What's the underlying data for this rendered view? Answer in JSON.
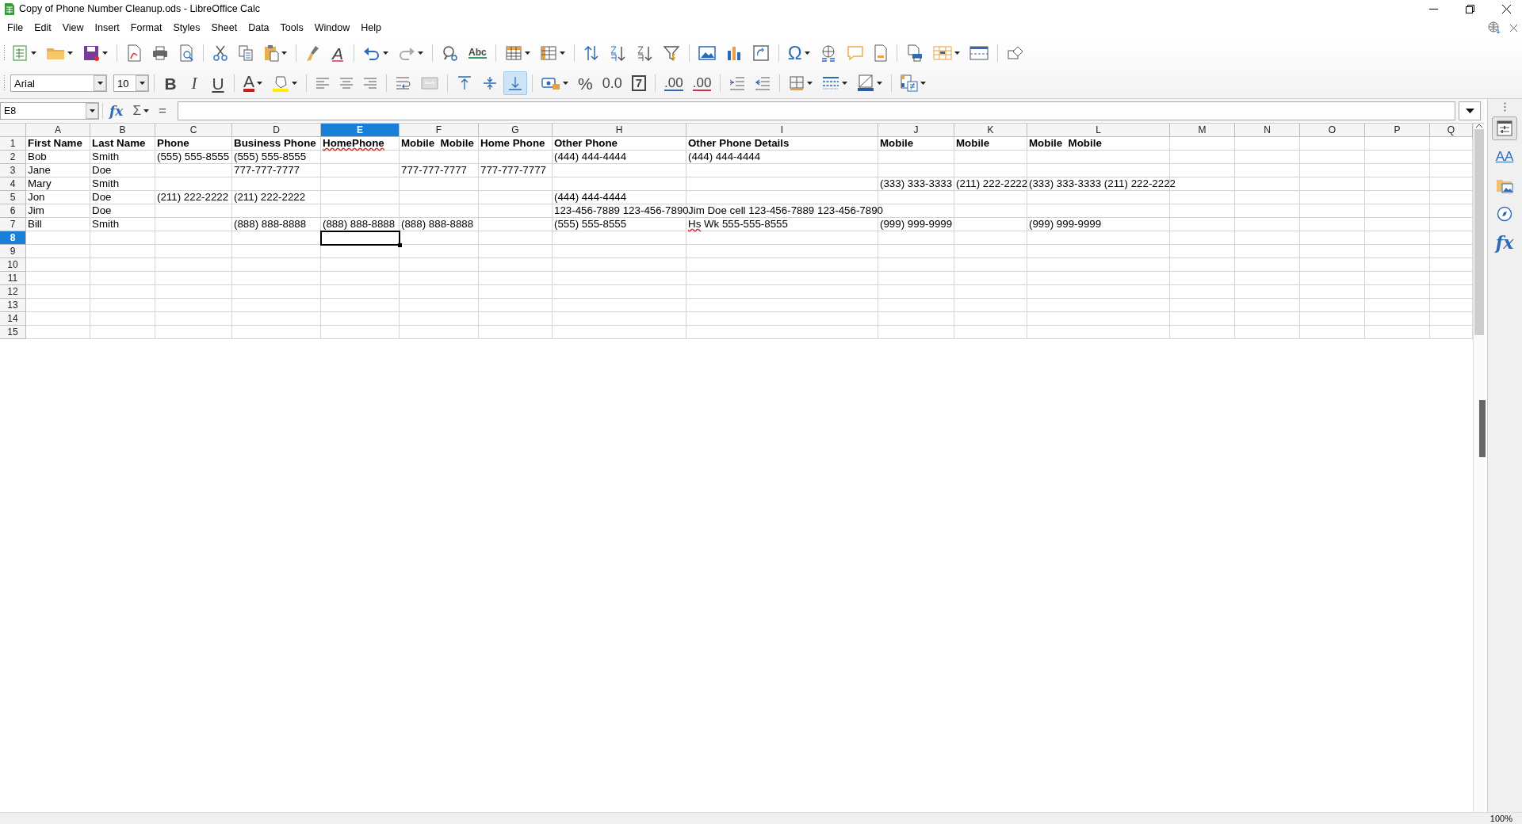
{
  "window": {
    "title": "Copy of Phone Number Cleanup.ods - LibreOffice Calc"
  },
  "menu": [
    {
      "label": "File"
    },
    {
      "label": "Edit"
    },
    {
      "label": "View"
    },
    {
      "label": "Insert"
    },
    {
      "label": "Format"
    },
    {
      "label": "Styles"
    },
    {
      "label": "Sheet"
    },
    {
      "label": "Data"
    },
    {
      "label": "Tools"
    },
    {
      "label": "Window"
    },
    {
      "label": "Help"
    }
  ],
  "standard_toolbar": {
    "clear_formatting_glyph": "A",
    "spellcheck_glyph": "Abc",
    "special_character_glyph": "Ω"
  },
  "formatting_toolbar": {
    "font_name": "Arial",
    "font_size": "10",
    "bold_glyph": "B",
    "italic_glyph": "I",
    "underline_glyph": "U",
    "font_color_glyph": "A",
    "percent_glyph": "%",
    "number_glyph": "0.0",
    "date_glyph": "7",
    "add_decimal_glyph": ".00",
    "delete_decimal_glyph": ".00",
    "vertical_align_buttons": [
      {
        "selected": false
      },
      {
        "selected": false
      },
      {
        "selected": true
      }
    ]
  },
  "formula_bar": {
    "name_box": "E8",
    "function_wizard_glyph": "fx",
    "sum_glyph": "Σ",
    "formula_glyph": "="
  },
  "sheet": {
    "columns": [
      {
        "label": "A",
        "selected": false
      },
      {
        "label": "B",
        "selected": false
      },
      {
        "label": "C",
        "selected": false
      },
      {
        "label": "D",
        "selected": false
      },
      {
        "label": "E",
        "selected": true
      },
      {
        "label": "F",
        "selected": false
      },
      {
        "label": "G",
        "selected": false
      },
      {
        "label": "H",
        "selected": false
      },
      {
        "label": "I",
        "selected": false
      },
      {
        "label": "J",
        "selected": false
      },
      {
        "label": "K",
        "selected": false
      },
      {
        "label": "L",
        "selected": false
      },
      {
        "label": "M",
        "selected": false
      },
      {
        "label": "N",
        "selected": false
      },
      {
        "label": "O",
        "selected": false
      },
      {
        "label": "P",
        "selected": false
      },
      {
        "label": "Q",
        "selected": false
      }
    ],
    "rows": [
      {
        "number": "1",
        "selected": false,
        "bold": true,
        "cells": [
          "First Name",
          "Last Name",
          "Phone",
          "Business Phone",
          {
            "text": "HomePhone",
            "misspelled_first_word": true
          },
          "Mobile  Mobile",
          "Home Phone",
          "Other Phone",
          "Other Phone Details",
          "Mobile",
          "Mobile",
          "Mobile  Mobile"
        ]
      },
      {
        "number": "2",
        "selected": false,
        "bold": false,
        "cells": [
          "Bob",
          "Smith",
          "(555) 555-8555",
          "(555) 555-8555",
          null,
          null,
          null,
          "(444) 444-4444",
          "(444) 444-4444"
        ]
      },
      {
        "number": "3",
        "selected": false,
        "bold": false,
        "cells": [
          "Jane",
          "Doe",
          null,
          "777-777-7777",
          null,
          "777-777-7777",
          "777-777-7777"
        ]
      },
      {
        "number": "4",
        "selected": false,
        "bold": false,
        "cells": [
          "Mary",
          "Smith",
          null,
          null,
          null,
          null,
          null,
          null,
          null,
          "(333) 333-3333",
          "(211) 222-2222",
          "(333) 333-3333 (211) 222-2222"
        ]
      },
      {
        "number": "5",
        "selected": false,
        "bold": false,
        "cells": [
          "Jon",
          "Doe",
          "(211) 222-2222",
          "(211) 222-2222",
          null,
          null,
          null,
          "(444) 444-4444"
        ]
      },
      {
        "number": "6",
        "selected": false,
        "bold": false,
        "cells": [
          "Jim",
          "Doe",
          null,
          null,
          null,
          null,
          null,
          "123-456-7889 123-456-7890",
          "Jim Doe cell 123-456-7889 123-456-7890"
        ]
      },
      {
        "number": "7",
        "selected": false,
        "bold": false,
        "cells": [
          "Bill",
          "Smith",
          null,
          "(888) 888-8888",
          "(888) 888-8888",
          "(888) 888-8888",
          null,
          "(555) 555-8555",
          {
            "text": "Hs Wk 555-555-8555",
            "misspelled_first_word": true
          },
          "(999) 999-9999",
          null,
          "(999) 999-9999"
        ]
      },
      {
        "number": "8",
        "selected": true,
        "cells": [
          null,
          null,
          null,
          null,
          {
            "selected": true
          }
        ]
      },
      {
        "number": "9",
        "selected": false,
        "cells": []
      },
      {
        "number": "10",
        "selected": false,
        "cells": []
      },
      {
        "number": "11",
        "selected": false,
        "cells": []
      },
      {
        "number": "12",
        "selected": false,
        "cells": []
      },
      {
        "number": "13",
        "selected": false,
        "cells": []
      },
      {
        "number": "14",
        "selected": false,
        "cells": []
      },
      {
        "number": "15",
        "selected": false,
        "cells": []
      }
    ]
  },
  "sidebar": {
    "styles_glyph": "AA",
    "functions_glyph": "fx"
  },
  "status_bar": {
    "zoom": "100%"
  }
}
